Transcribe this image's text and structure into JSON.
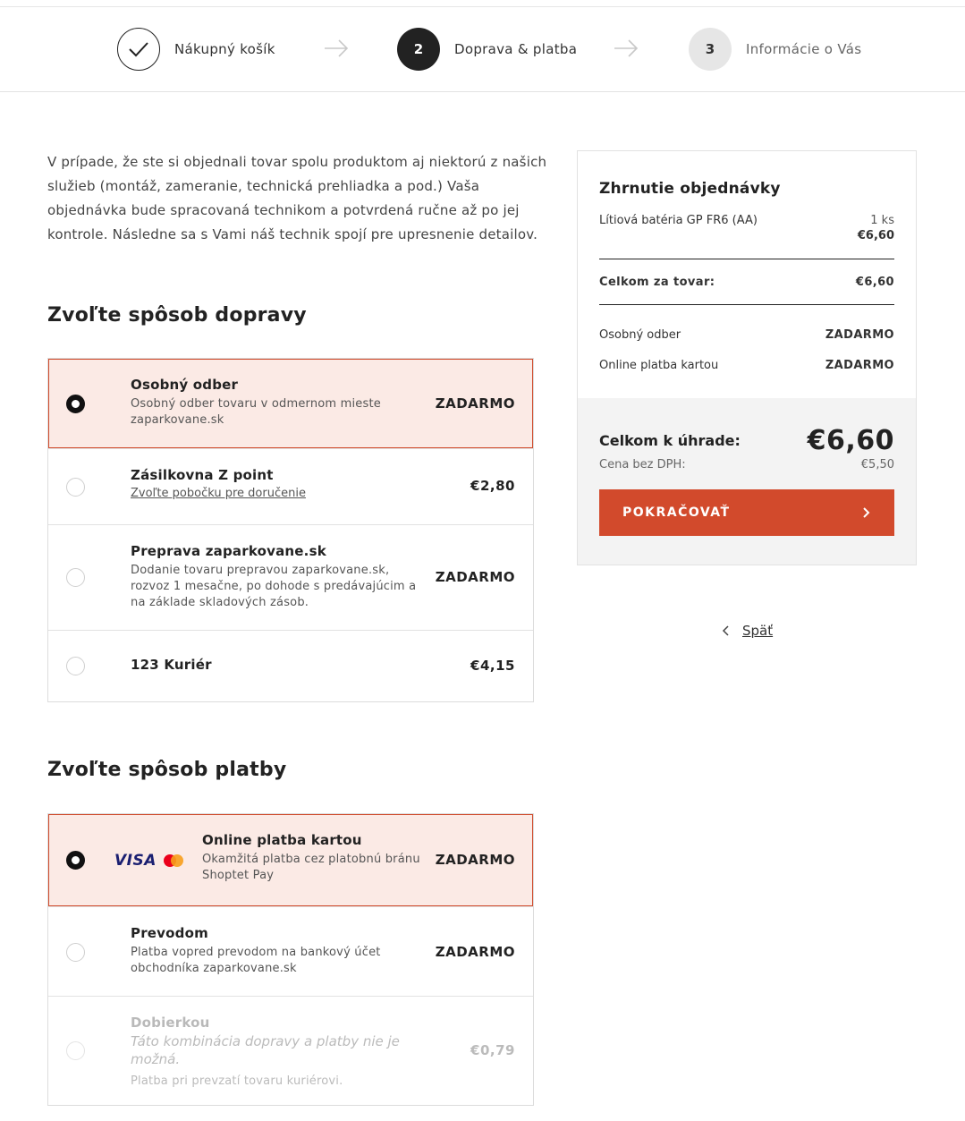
{
  "steps": [
    {
      "number": "",
      "label": "Nákupný košík"
    },
    {
      "number": "2",
      "label": "Doprava & platba"
    },
    {
      "number": "3",
      "label": "Informácie o Vás"
    }
  ],
  "intro": "V prípade, že ste si objednali tovar spolu produktom aj niektorú z našich služieb (montáž, zameranie, technická prehliadka a pod.) Vaša objednávka bude spracovaná technikom a potvrdená ručne až po jej kontrole. Následne sa s Vami náš technik spojí pre upresnenie detailov.",
  "shipping": {
    "title": "Zvoľte spôsob dopravy",
    "options": [
      {
        "name": "Osobný odber",
        "desc": "Osobný odber tovaru v odmernom mieste zaparkovane.sk",
        "price": "ZADARMO",
        "selected": true
      },
      {
        "name": "Zásilkovna Z point",
        "link": "Zvoľte pobočku pre doručenie",
        "price": "€2,80"
      },
      {
        "name": "Preprava zaparkovane.sk",
        "desc": "Dodanie tovaru prepravou zaparkovane.sk, rozvoz 1 mesačne, po dohode s predávajúcim a na základe skladových zásob.",
        "price": "ZADARMO"
      },
      {
        "name": "123 Kuriér",
        "price": "€4,15"
      }
    ]
  },
  "payment": {
    "title": "Zvoľte spôsob platby",
    "options": [
      {
        "name": "Online platba kartou",
        "desc": "Okamžitá platba cez platobnú bránu Shoptet Pay",
        "price": "ZADARMO",
        "selected": true,
        "logos": [
          "visa-logo",
          "mastercard-logo"
        ],
        "visa_text": "VISA"
      },
      {
        "name": "Prevodom",
        "desc": "Platba vopred prevodom na bankový účet obchodníka zaparkovane.sk",
        "price": "ZADARMO"
      },
      {
        "name": "Dobierkou",
        "warning": "Táto kombinácia dopravy a platby nie je možná.",
        "desc": "Platba pri prevzatí tovaru kuriérovi.",
        "price": "€0,79",
        "disabled": true
      }
    ]
  },
  "summary": {
    "title": "Zhrnutie objednávky",
    "item": {
      "name": "Lítiová batéria GP FR6 (AA)",
      "qty": "1 ks",
      "price": "€6,60"
    },
    "goods_total_label": "Celkom za tovar:",
    "goods_total": "€6,60",
    "shipping_label": "Osobný odber",
    "shipping_price": "ZADARMO",
    "payment_label": "Online platba kartou",
    "payment_price": "ZADARMO",
    "total_label": "Celkom k úhrade:",
    "total": "€6,60",
    "vat_label": "Cena bez DPH:",
    "vat_value": "€5,50",
    "continue_label": "POKRAČOVAŤ",
    "back_label": "Späť"
  },
  "colors": {
    "accent": "#d24a2c",
    "selected_bg": "#fbeae5",
    "dark": "#222222"
  }
}
